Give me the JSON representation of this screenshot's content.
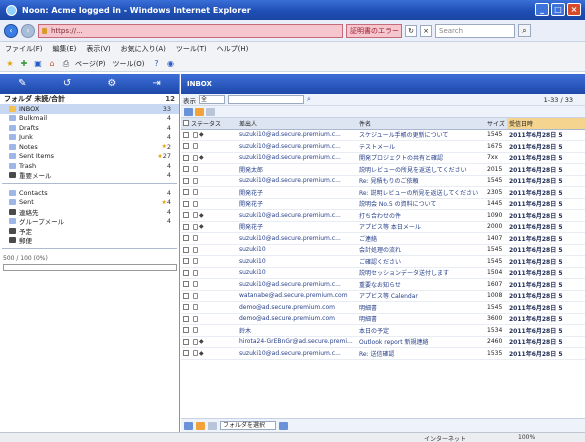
{
  "window": {
    "title": "Noon: Acme logged in - Windows Internet Explorer",
    "buttons": [
      "_",
      "□",
      "×"
    ]
  },
  "address_bar": {
    "url": "https://...",
    "cert_label": "証明書のエラー",
    "search_placeholder": "Search",
    "search_icon": "magnifier-icon"
  },
  "menu": [
    "ファイル(F)",
    "編集(E)",
    "表示(V)",
    "お気に入り(A)",
    "ツール(T)",
    "ヘルプ(H)"
  ],
  "toolbar": {
    "items": [
      "ページ(P)",
      "ツール(O)"
    ]
  },
  "left_panel": {
    "tool_icons": [
      "compose-icon",
      "reply-icon",
      "settings-icon",
      "logout-icon"
    ],
    "header": {
      "title": "フォルダ 未読/合計",
      "count": "12"
    },
    "folders": [
      {
        "name": "INBOX",
        "count": "33",
        "color": "#f2c14e",
        "selected": true
      },
      {
        "name": "Bulkmail",
        "count": "4",
        "color": "#9fb7e6"
      },
      {
        "name": "Drafts",
        "count": "4",
        "color": "#9fb7e6"
      },
      {
        "name": "Junk",
        "count": "4",
        "color": "#9fb7e6"
      },
      {
        "name": "Notes",
        "count": "2",
        "color": "#9fb7e6",
        "star": true
      },
      {
        "name": "Sent Items",
        "count": "27",
        "color": "#9fb7e6",
        "star": true
      },
      {
        "name": "Trash",
        "count": "4",
        "color": "#9fb7e6"
      },
      {
        "name": "重要メール",
        "count": "4",
        "color": "#4a4a4a"
      }
    ],
    "groups": [
      {
        "name": "Contacts",
        "count": "4",
        "color": "#9fb7e6"
      },
      {
        "name": "Sent",
        "count": "4",
        "color": "#9fb7e6",
        "star": true
      },
      {
        "name": "連絡先",
        "count": "4",
        "color": "#4a4a4a"
      },
      {
        "name": "グループメール",
        "count": "4",
        "color": "#9fb7e6"
      },
      {
        "name": "予定",
        "count": "",
        "color": "#4a4a4a"
      },
      {
        "name": "郵便",
        "count": "",
        "color": "#4a4a4a"
      }
    ],
    "quota_label": "500 / 100 (0%)"
  },
  "right_panel": {
    "title": "INBOX",
    "filter_label": "表示",
    "filter_value": "全",
    "pager": "1-33 / 33",
    "columns": [
      "",
      "ステータス",
      "差出人",
      "件名",
      "サイズ",
      "受信日時"
    ],
    "rows": [
      {
        "attach": true,
        "from": "suzuki10@ad.secure.premium.c...",
        "subject": "スケジュール手帳の更新について",
        "size": "1545",
        "date": "2011年6月28日 5"
      },
      {
        "attach": false,
        "from": "suzuki10@ad.secure.premium.c...",
        "subject": "テストメール",
        "size": "1675",
        "date": "2011年6月28日 5"
      },
      {
        "attach": true,
        "from": "suzuki10@ad.secure.premium.c...",
        "subject": "開発プロジェクトの共有と確認",
        "size": "7xx",
        "date": "2011年6月28日 5"
      },
      {
        "attach": false,
        "from": "開発太郎",
        "subject": "説明レビューの所見を返送してください",
        "size": "2015",
        "date": "2011年6月28日 5"
      },
      {
        "attach": false,
        "from": "suzuki10@ad.secure.premium.c...",
        "subject": "Re: 見積もりのご依頼",
        "size": "1545",
        "date": "2011年6月28日 5"
      },
      {
        "attach": false,
        "from": "開発花子",
        "subject": "Re: 説明レビューの所見を返送してください",
        "size": "2305",
        "date": "2011年6月28日 5"
      },
      {
        "attach": false,
        "from": "開発花子",
        "subject": "説明会 No.5 の資料について",
        "size": "1445",
        "date": "2011年6月28日 5"
      },
      {
        "attach": true,
        "from": "suzuki10@ad.secure.premium.c...",
        "subject": "打ち合わせの件",
        "size": "1090",
        "date": "2011年6月28日 5"
      },
      {
        "attach": true,
        "from": "開発花子",
        "subject": "アプビス等 本日メール",
        "size": "2000",
        "date": "2011年6月28日 5"
      },
      {
        "attach": false,
        "from": "suzuki10@ad.secure.premium.c...",
        "subject": "ご連絡",
        "size": "1407",
        "date": "2011年6月28日 5"
      },
      {
        "attach": false,
        "from": "suzuki10",
        "subject": "会計処理の流れ",
        "size": "1545",
        "date": "2011年6月28日 5"
      },
      {
        "attach": false,
        "from": "suzuki10",
        "subject": "ご確認ください",
        "size": "1545",
        "date": "2011年6月28日 5"
      },
      {
        "attach": false,
        "from": "suzuki10",
        "subject": "説明セッションデータ送付します",
        "size": "1504",
        "date": "2011年6月28日 5"
      },
      {
        "attach": false,
        "from": "suzuki10@ad.secure.premium.c...",
        "subject": "重要なお知らせ",
        "size": "1607",
        "date": "2011年6月28日 5"
      },
      {
        "attach": false,
        "from": "watanabe@ad.secure.premium.com",
        "subject": "アプビス等 Calendar",
        "size": "1008",
        "date": "2011年6月28日 5"
      },
      {
        "attach": false,
        "from": "demo@ad.secure.premium.com",
        "subject": "明細書",
        "size": "1545",
        "date": "2011年6月28日 5"
      },
      {
        "attach": false,
        "from": "demo@ad.secure.premium.com",
        "subject": "明細書",
        "size": "3600",
        "date": "2011年6月28日 5"
      },
      {
        "attach": false,
        "from": "鈴木",
        "subject": "本日の予定",
        "size": "1534",
        "date": "2011年6月28日 5"
      },
      {
        "attach": true,
        "from": "hirota24-GrEBnGr@ad.secure.premi...",
        "subject": "Outlook report 新規連絡",
        "size": "2460",
        "date": "2011年6月28日 5"
      },
      {
        "attach": true,
        "from": "suzuki10@ad.secure.premium.c...",
        "subject": "Re: 送信確認",
        "size": "1535",
        "date": "2011年6月28日 5"
      }
    ],
    "move_folder_label": "フォルダを選択"
  },
  "status_bar": {
    "zone": "インターネット",
    "zoom": "100%"
  }
}
